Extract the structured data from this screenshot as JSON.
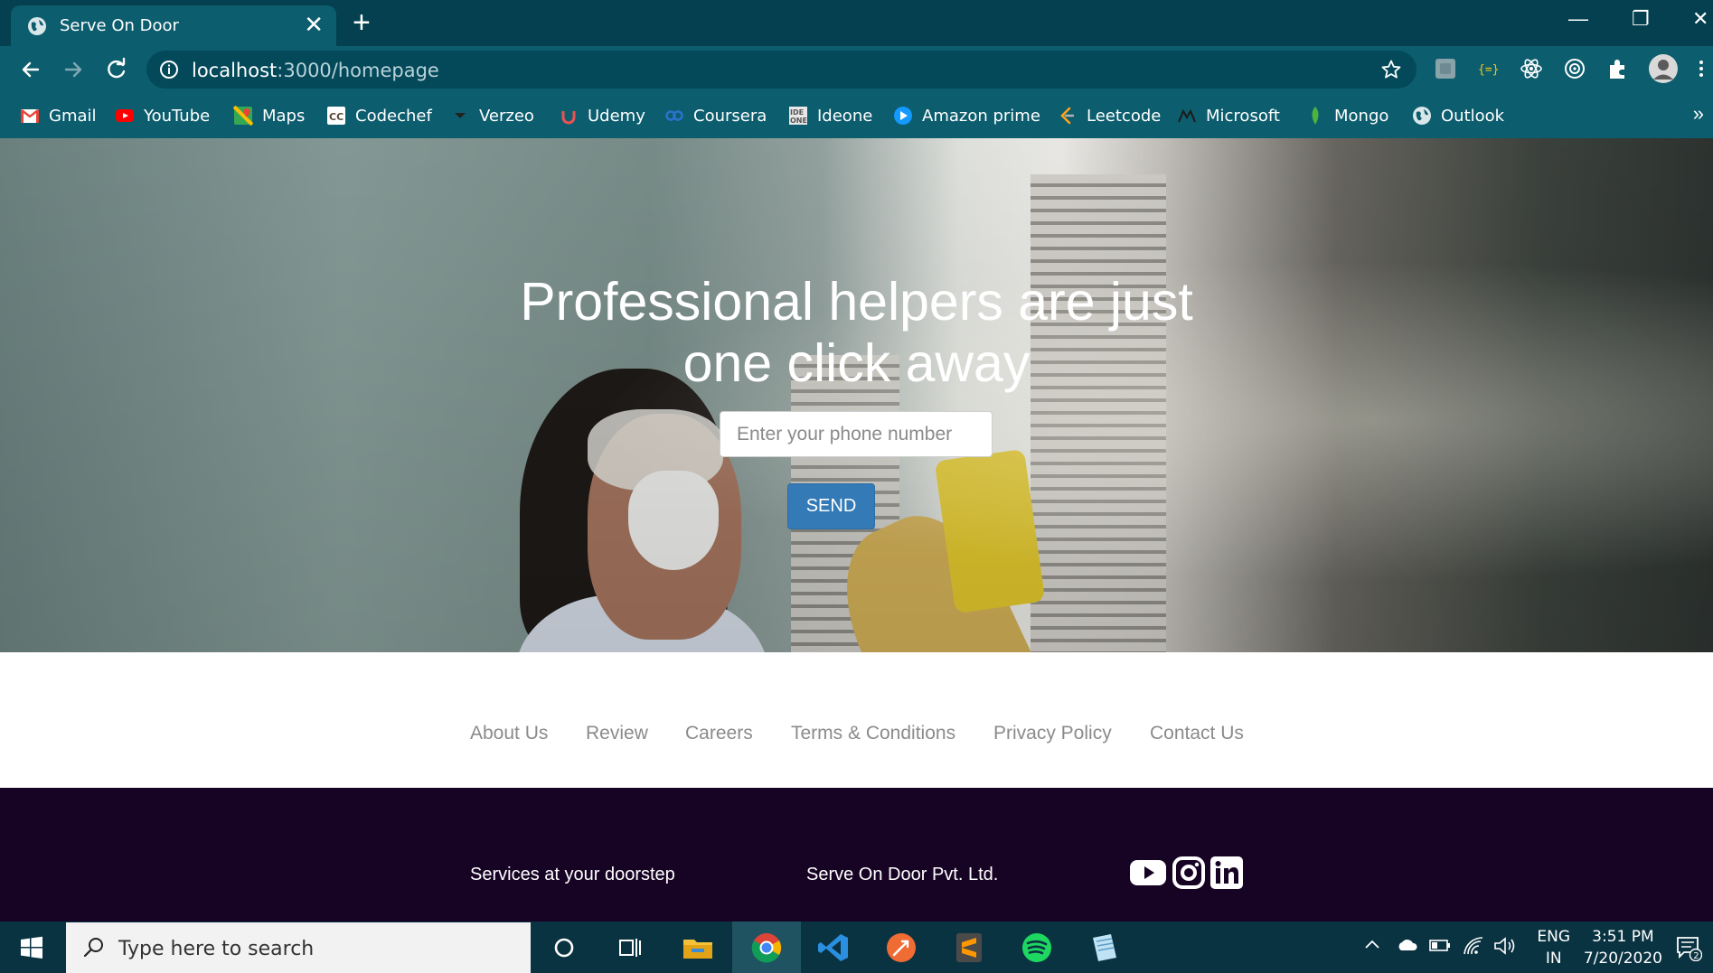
{
  "browser": {
    "tab": {
      "title": "Serve On Door",
      "close": "✕"
    },
    "new_tab": "+",
    "window": {
      "minimize": "—",
      "restore": "❐",
      "close": "✕"
    },
    "url_host": "localhost",
    "url_path": ":3000/homepage",
    "bookmarks": [
      {
        "label": "Gmail",
        "icon": "gmail-icon",
        "color": "#ea4335"
      },
      {
        "label": "YouTube",
        "icon": "youtube-icon",
        "color": "#ff0000"
      },
      {
        "label": "Maps",
        "icon": "maps-icon",
        "color": "#34a853"
      },
      {
        "label": "Codechef",
        "icon": "codechef-icon",
        "color": "#5b4638"
      },
      {
        "label": "Verzeo",
        "icon": "verzeo-icon",
        "color": "#222222"
      },
      {
        "label": "Udemy",
        "icon": "udemy-icon",
        "color": "#ec5252"
      },
      {
        "label": "Coursera",
        "icon": "coursera-icon",
        "color": "#2a73cc"
      },
      {
        "label": "Ideone",
        "icon": "ideone-icon",
        "color": "#6b6b6b"
      },
      {
        "label": "Amazon prime",
        "icon": "prime-video-icon",
        "color": "#1399ff"
      },
      {
        "label": "Leetcode",
        "icon": "leetcode-icon",
        "color": "#ffa116"
      },
      {
        "label": "Microsoft",
        "icon": "microsoft-icon",
        "color": "#1b1b1b"
      },
      {
        "label": "Mongo",
        "icon": "mongodb-leaf-icon",
        "color": "#4db33d"
      },
      {
        "label": "Outlook",
        "icon": "globe-icon",
        "color": "#d9e6ea"
      }
    ],
    "bookmarks_more": "»"
  },
  "hero": {
    "title": "Professional helpers are just one click away",
    "phone_placeholder": "Enter your phone number",
    "send_label": "SEND"
  },
  "footer_links": [
    "About Us",
    "Review",
    "Careers",
    "Terms & Conditions",
    "Privacy Policy",
    "Contact Us"
  ],
  "footer": {
    "tagline": "Services at your doorstep",
    "company": "Serve On Door Pvt. Ltd.",
    "social": [
      "youtube-icon",
      "instagram-icon",
      "linkedin-icon"
    ]
  },
  "taskbar": {
    "search_placeholder": "Type here to search",
    "language": "ENG",
    "region": "IN",
    "time": "3:51 PM",
    "date": "7/20/2020",
    "notifications": "2"
  },
  "colors": {
    "tab_strip": "#04404f",
    "toolbar": "#0c5d6e",
    "send_button": "#337ab7",
    "footer_dark": "#170324",
    "footer_link": "#8b8b8b",
    "taskbar": "#0a3342"
  }
}
